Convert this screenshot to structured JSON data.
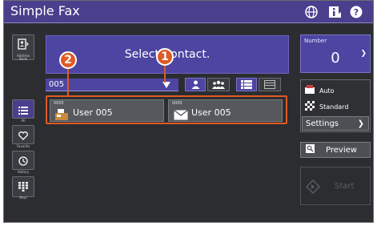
{
  "app": {
    "title": "Simple Fax"
  },
  "titlebar_icons": [
    "globe-icon",
    "info-icon",
    "help-icon"
  ],
  "sidebar": {
    "items": [
      {
        "label": "Address Book",
        "icon": "address-book-icon"
      },
      {
        "label": "All",
        "icon": "list-icon",
        "active": true
      },
      {
        "label": "Favorite",
        "icon": "heart-icon"
      },
      {
        "label": "History",
        "icon": "history-icon"
      },
      {
        "label": "Keys",
        "icon": "keypad-icon"
      }
    ]
  },
  "main": {
    "select_contact_label": "Select Contact.",
    "search": {
      "value": "005"
    },
    "view_toggles": [
      "single-user-icon",
      "group-icon",
      "list-view-icon",
      "detail-view-icon"
    ],
    "results": [
      {
        "number": "0005",
        "name": "User 005",
        "icon": "fax-icon"
      },
      {
        "number": "0005",
        "name": "User 005",
        "icon": "email-icon"
      }
    ]
  },
  "callouts": [
    {
      "label": "1"
    },
    {
      "label": "2"
    }
  ],
  "right_panel": {
    "number_label": "Number",
    "number_value": "0",
    "settings": [
      {
        "label": "Auto",
        "icon": "paper-icon"
      },
      {
        "label": "Standard",
        "icon": "resolution-icon"
      }
    ],
    "settings_button": "Settings",
    "preview_button": "Preview",
    "start_button": "Start"
  },
  "colors": {
    "accent": "#4d45a1",
    "titlebar": "#4a3f8c",
    "callout": "#e05a24",
    "background": "#2b2d31"
  }
}
